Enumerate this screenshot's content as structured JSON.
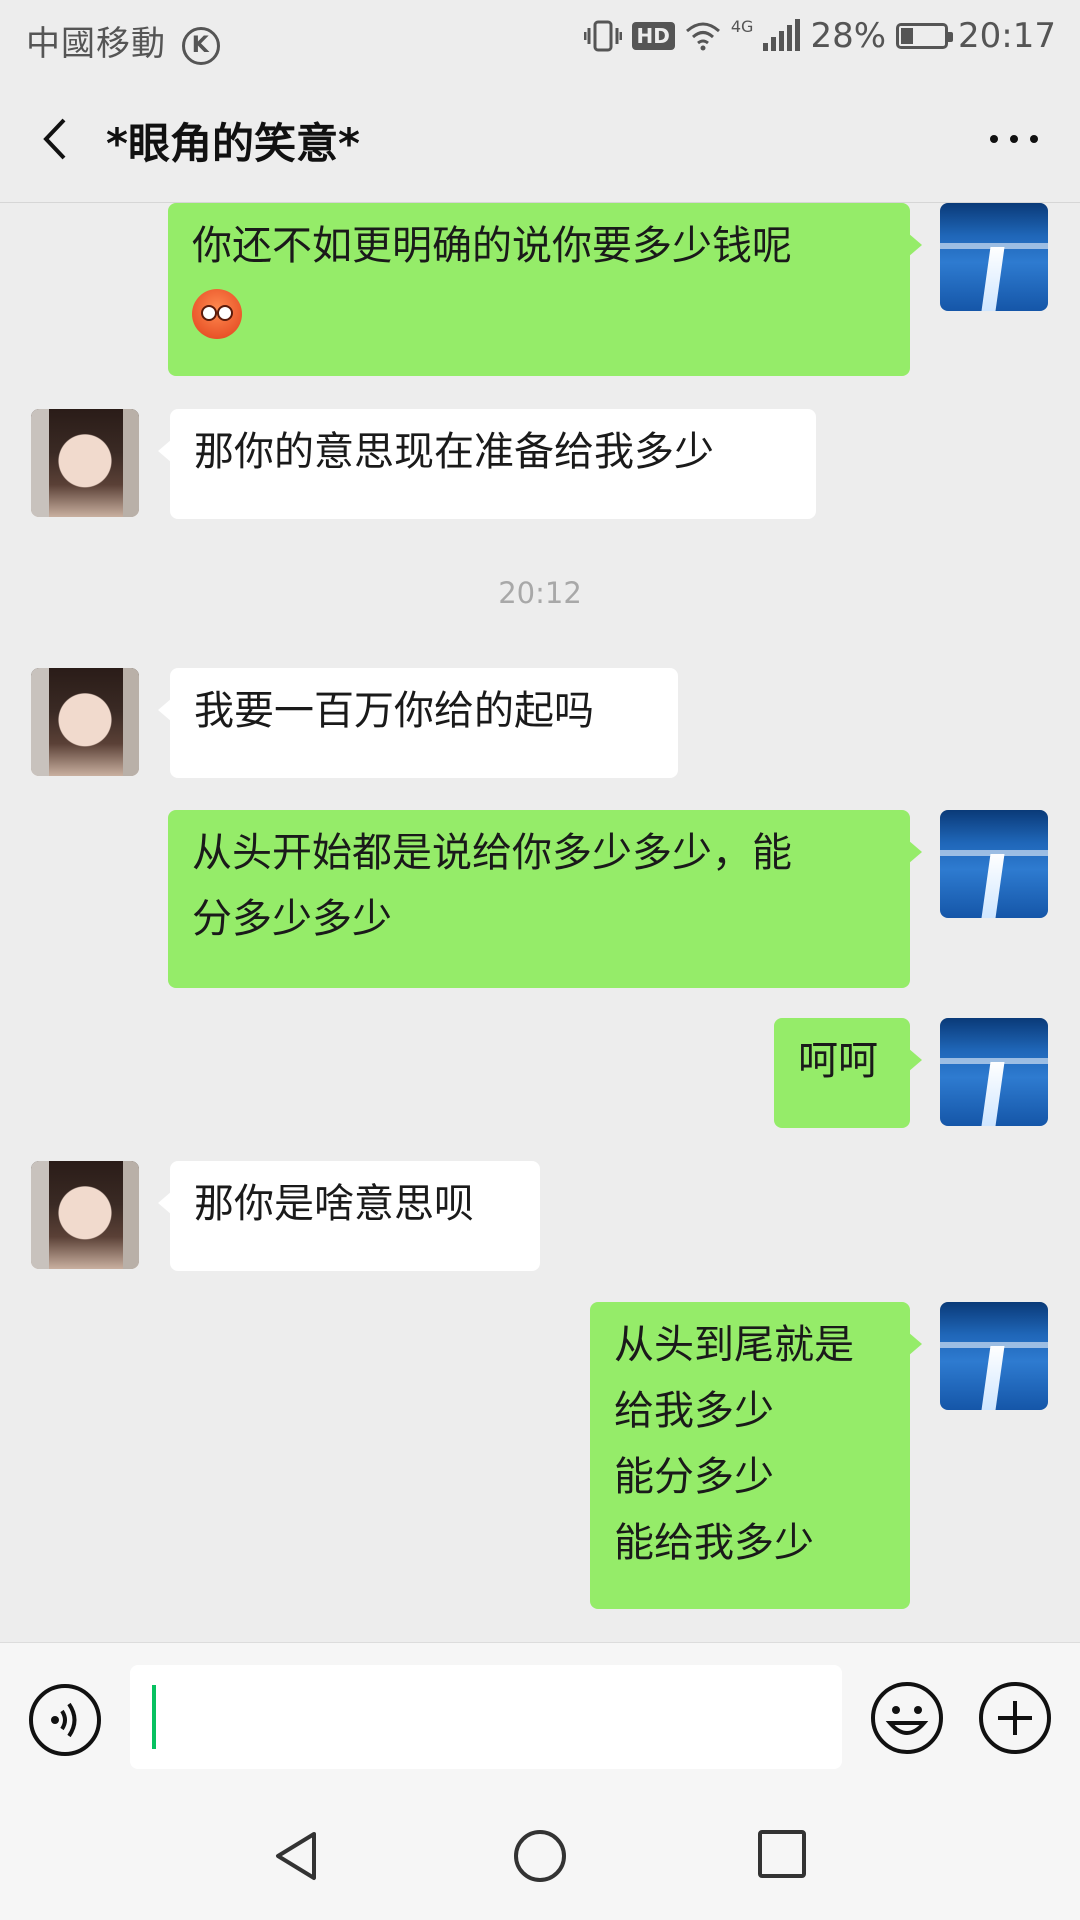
{
  "status_bar": {
    "carrier": "中國移動",
    "carrier_badge": "K",
    "hd_label": "HD",
    "network": "4G",
    "battery_percent": "28%",
    "battery_level": 0.28,
    "time": "20:17"
  },
  "header": {
    "title": "*眼角的笑意*",
    "back_icon": "chevron-left-icon",
    "more_icon": "more-dots-icon"
  },
  "messages": [
    {
      "sender": "self",
      "text": "你还不如更明确的说你要多少钱呢",
      "emoji": "hot-face-emoji"
    },
    {
      "sender": "other",
      "text": "那你的意思现在准备给我多少"
    },
    {
      "sender": "other",
      "text": "我要一百万你给的起吗"
    },
    {
      "sender": "self",
      "line1": "从头开始都是说给你多少多少，能",
      "line2": "分多少多少"
    },
    {
      "sender": "self",
      "text": "呵呵"
    },
    {
      "sender": "other",
      "text": "那你是啥意思呗"
    },
    {
      "sender": "self",
      "lines": [
        "从头到尾就是",
        "给我多少",
        "能分多少",
        "能给我多少"
      ]
    }
  ],
  "timestamp": "20:12",
  "input_bar": {
    "voice_icon": "voice-icon",
    "text_value": "",
    "emoji_icon": "emoji-icon",
    "plus_icon": "plus-icon"
  },
  "colors": {
    "background": "#ededed",
    "outgoing_bubble": "#95ec69",
    "incoming_bubble": "#ffffff",
    "caret": "#07c160"
  }
}
